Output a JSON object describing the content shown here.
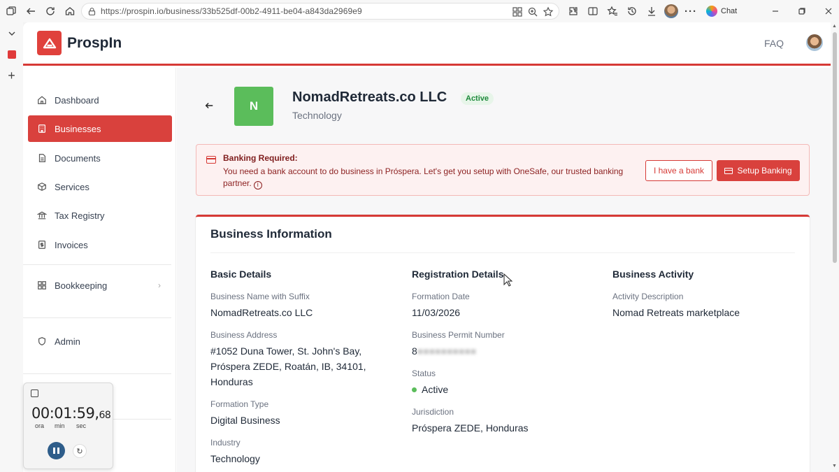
{
  "browser": {
    "url": "https://prospin.io/business/33b525df-00b2-4911-be04-a843da2969e9",
    "chat_label": "Chat"
  },
  "app": {
    "brand": "ProspIn",
    "faq_label": "FAQ"
  },
  "sidebar": {
    "items": [
      {
        "label": "Dashboard",
        "icon": "home-icon"
      },
      {
        "label": "Businesses",
        "icon": "building-icon",
        "active": true
      },
      {
        "label": "Documents",
        "icon": "document-icon"
      },
      {
        "label": "Services",
        "icon": "box-icon"
      },
      {
        "label": "Tax Registry",
        "icon": "bank-icon"
      },
      {
        "label": "Invoices",
        "icon": "invoice-icon"
      },
      {
        "label": "Bookkeeping",
        "icon": "grid-icon"
      },
      {
        "label": "Admin",
        "icon": "shield-icon"
      }
    ]
  },
  "business": {
    "initial": "N",
    "name": "NomadRetreats.co LLC",
    "status_badge": "Active",
    "category": "Technology"
  },
  "alert": {
    "title": "Banking Required:",
    "body": "You need a bank account to do business in Próspera. Let's get you setup with OneSafe, our trusted banking partner.",
    "have_bank_label": "I have a bank",
    "setup_label": "Setup Banking"
  },
  "info": {
    "title": "Business Information",
    "basic": {
      "heading": "Basic Details",
      "name_label": "Business Name with Suffix",
      "name_value": "NomadRetreats.co LLC",
      "address_label": "Business Address",
      "address_value": "#1052 Duna Tower, St. John's Bay, Próspera ZEDE, Roatán, IB, 34101, Honduras",
      "formation_type_label": "Formation Type",
      "formation_type_value": "Digital Business",
      "industry_label": "Industry",
      "industry_value": "Technology"
    },
    "registration": {
      "heading": "Registration Details",
      "formation_date_label": "Formation Date",
      "formation_date_value": "11/03/2026",
      "permit_label": "Business Permit Number",
      "permit_value": "8",
      "status_label": "Status",
      "status_value": "Active",
      "jurisdiction_label": "Jurisdiction",
      "jurisdiction_value": "Próspera ZEDE, Honduras"
    },
    "activity": {
      "heading": "Business Activity",
      "desc_label": "Activity Description",
      "desc_value": "Nomad Retreats marketplace"
    }
  },
  "timer": {
    "time": "00:01:59,",
    "hundredths": "68",
    "unit_h": "ora",
    "unit_m": "min",
    "unit_s": "sec"
  },
  "colors": {
    "brand_red": "#d9413d",
    "active_green": "#5bbd5b"
  }
}
